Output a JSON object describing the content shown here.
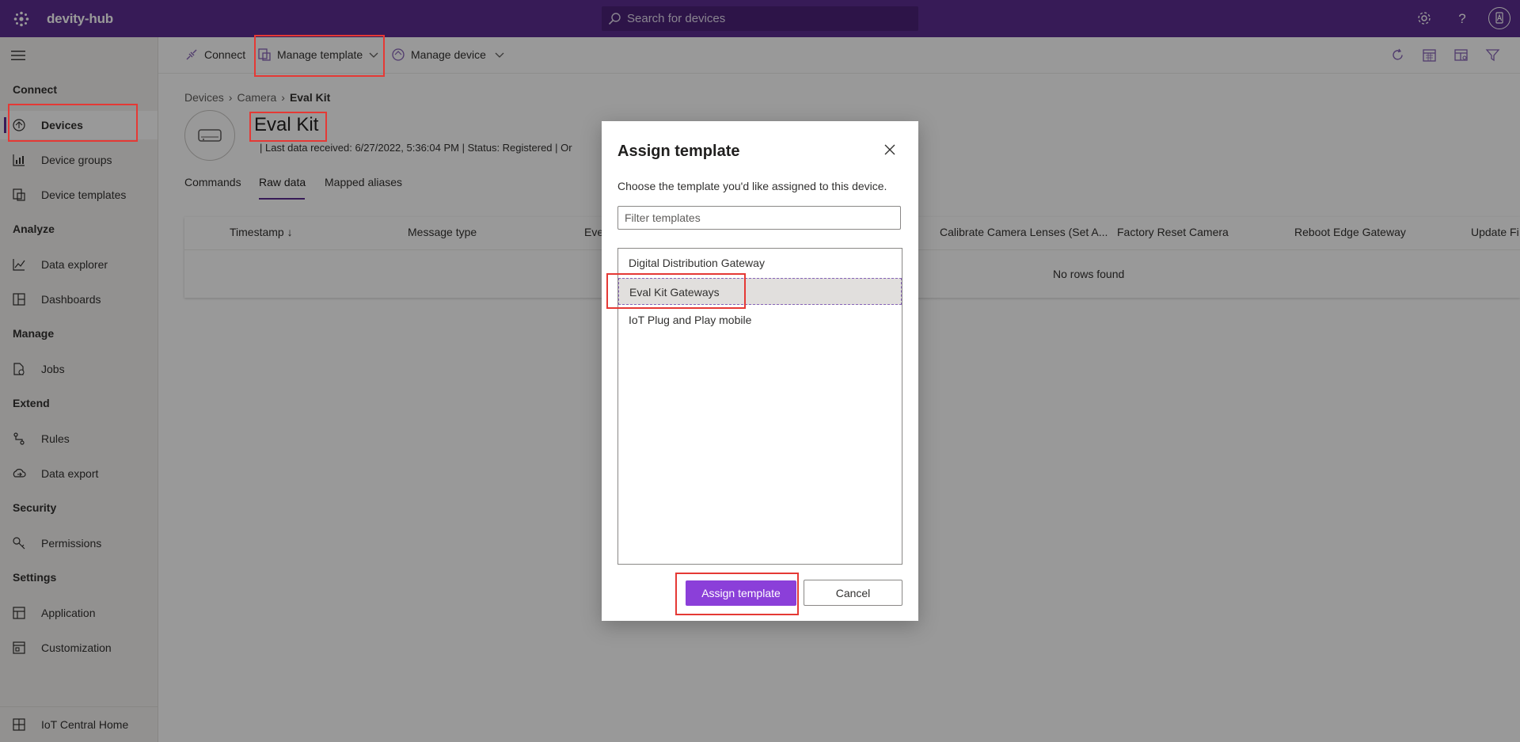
{
  "topbar": {
    "app_name": "devity-hub",
    "search_placeholder": "Search for devices",
    "background": "#5c2d91"
  },
  "sidenav": {
    "sections": [
      {
        "label": "Connect"
      },
      {
        "label": "Analyze"
      },
      {
        "label": "Manage"
      },
      {
        "label": "Extend"
      },
      {
        "label": "Security"
      },
      {
        "label": "Settings"
      }
    ],
    "items": [
      {
        "label": "Devices",
        "icon": "devices-icon",
        "active": true
      },
      {
        "label": "Device groups",
        "icon": "device-groups-icon"
      },
      {
        "label": "Device templates",
        "icon": "device-templates-icon"
      },
      {
        "label": "Data explorer",
        "icon": "data-explorer-icon"
      },
      {
        "label": "Dashboards",
        "icon": "dashboards-icon"
      },
      {
        "label": "Jobs",
        "icon": "jobs-icon"
      },
      {
        "label": "Rules",
        "icon": "rules-icon"
      },
      {
        "label": "Data export",
        "icon": "data-export-icon"
      },
      {
        "label": "Permissions",
        "icon": "permissions-icon"
      },
      {
        "label": "Application",
        "icon": "application-icon"
      },
      {
        "label": "Customization",
        "icon": "customization-icon"
      }
    ],
    "footer_item": {
      "label": "IoT Central Home",
      "icon": "home-icon"
    }
  },
  "cmdbar": {
    "connect": "Connect",
    "manage_template": "Manage template",
    "manage_device": "Manage device"
  },
  "breadcrumb": {
    "devices": "Devices",
    "camera": "Camera",
    "current": "Eval Kit"
  },
  "device": {
    "name": "Eval Kit",
    "meta": "|  Last data received: 6/27/2022, 5:36:04 PM  |  Status: Registered  |  Or"
  },
  "tabs": [
    {
      "label": "Commands"
    },
    {
      "label": "Raw data",
      "active": true
    },
    {
      "label": "Mapped aliases"
    }
  ],
  "table": {
    "columns": [
      "Timestamp ↓",
      "Message type",
      "Eve",
      "Calibrate Camera Lenses (Set A...",
      "Factory Reset Camera",
      "Reboot Edge Gateway",
      "Update Fi"
    ],
    "empty_text": "No rows found"
  },
  "dialog": {
    "title": "Assign template",
    "description": "Choose the template you'd like assigned to this device.",
    "filter_placeholder": "Filter templates",
    "templates": [
      {
        "label": "Digital Distribution Gateway"
      },
      {
        "label": "Eval Kit Gateways",
        "selected": true
      },
      {
        "label": "IoT Plug and Play mobile"
      }
    ],
    "primary_button": "Assign template",
    "cancel_button": "Cancel",
    "accent": "#8b3fd9"
  },
  "highlight_color": "#e53935"
}
